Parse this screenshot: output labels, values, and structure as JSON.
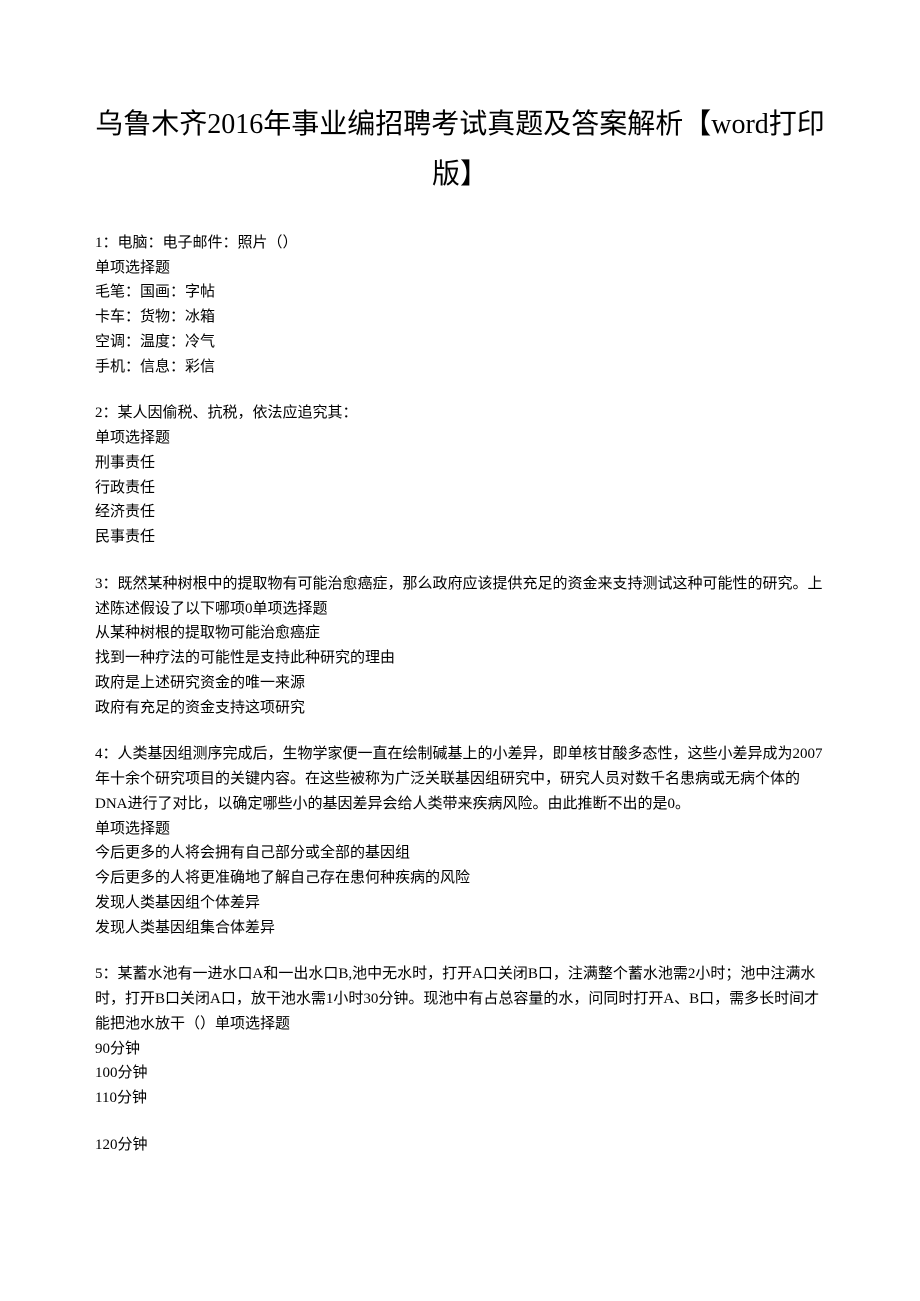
{
  "title": "乌鲁木齐2016年事业编招聘考试真题及答案解析【word打印版】",
  "questions": [
    {
      "stem": "1：电脑：电子邮件：照片（）",
      "type": "单项选择题",
      "options": [
        "毛笔：国画：字帖",
        "卡车：货物：冰箱",
        "空调：温度：冷气",
        "手机：信息：彩信"
      ]
    },
    {
      "stem": "2：某人因偷税、抗税，依法应追究其：",
      "type": "单项选择题",
      "options": [
        "刑事责任",
        "行政责任",
        "经济责任",
        "民事责任"
      ]
    },
    {
      "stem": "3：既然某种树根中的提取物有可能治愈癌症，那么政府应该提供充足的资金来支持测试这种可能性的研究。上述陈述假设了以下哪项0单项选择题",
      "type": "",
      "options": [
        "从某种树根的提取物可能治愈癌症",
        "找到一种疗法的可能性是支持此种研究的理由",
        "政府是上述研究资金的唯一来源",
        "政府有充足的资金支持这项研究"
      ]
    },
    {
      "stem": "4：人类基因组测序完成后，生物学家便一直在绘制碱基上的小差异，即单核甘酸多态性，这些小差异成为2007年十余个研究项目的关键内容。在这些被称为广泛关联基因组研究中，研究人员对数千名患病或无病个体的DNA进行了对比，以确定哪些小的基因差异会给人类带来疾病风险。由此推断不出的是0。",
      "type": "单项选择题",
      "options": [
        "今后更多的人将会拥有自己部分或全部的基因组",
        "今后更多的人将更准确地了解自己存在患何种疾病的风险",
        "发现人类基因组个体差异",
        "发现人类基因组集合体差异"
      ]
    },
    {
      "stem": "5：某蓄水池有一进水口A和一出水口B,池中无水时，打开A口关闭B口，注满整个蓄水池需2小时；池中注满水时，打开B口关闭A口，放干池水需1小时30分钟。现池中有占总容量的水，问同时打开A、B口，需多长时间才能把池水放干（）单项选择题",
      "type": "",
      "options": [
        "90分钟",
        "100分钟",
        "110分钟"
      ]
    },
    {
      "stem": "",
      "type": "",
      "options": [
        "120分钟"
      ]
    }
  ]
}
